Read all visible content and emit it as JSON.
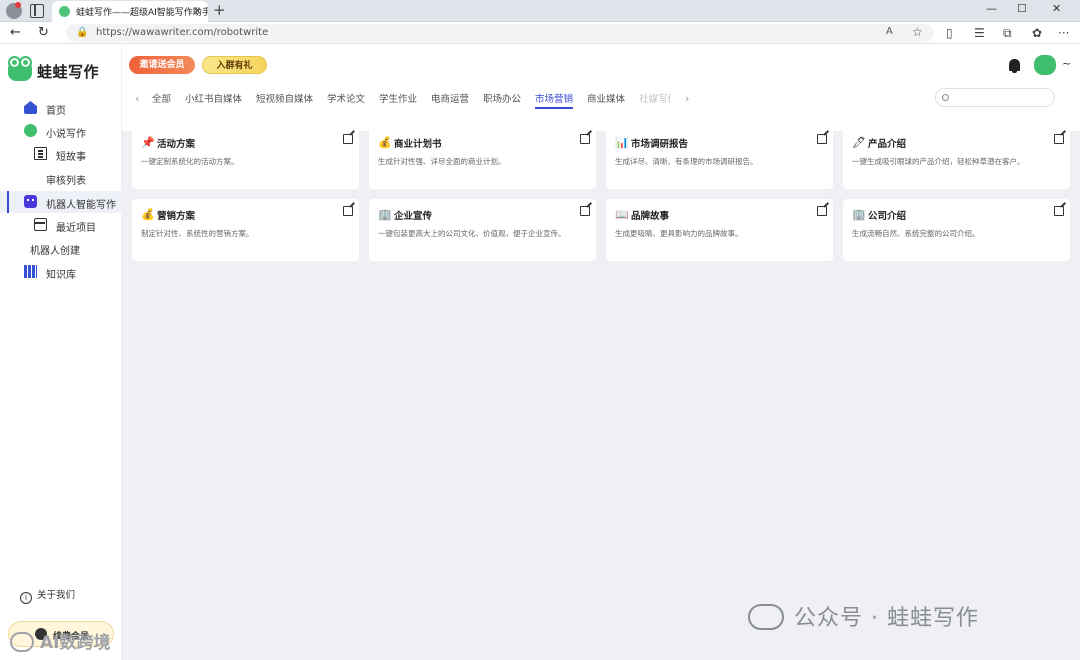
{
  "browser": {
    "tab_title": "蛙蛙写作——超级AI智能写作助手",
    "tab_close": "×",
    "new_tab": "+",
    "url": "https://wawawriter.com/robotwrite",
    "win_min": "—",
    "win_max": "☐",
    "win_close": "✕",
    "back": "←",
    "refresh": "↻",
    "read_aloud": "A",
    "favorite": "☆",
    "ellipsis": "···"
  },
  "sidebar": {
    "app_name": "蛙蛙写作",
    "items": [
      {
        "label": "首页",
        "icon": "home-icon"
      },
      {
        "label": "小说写作",
        "icon": "frog-icon"
      },
      {
        "label": "短故事",
        "icon": "book-icon"
      },
      {
        "label": "审核列表",
        "icon": ""
      },
      {
        "label": "机器人智能写作",
        "icon": "robot-icon"
      },
      {
        "label": "最近项目",
        "icon": "box-icon"
      },
      {
        "label": "机器人创建",
        "icon": ""
      },
      {
        "label": "知识库",
        "icon": "library-icon"
      }
    ],
    "active_index": 4,
    "about_label": "关于我们",
    "about_icon_char": "i",
    "member_label": "续费会员"
  },
  "header": {
    "invite_label": "邀请送会员",
    "group_label": "入群有礼",
    "user_suffix": "~"
  },
  "categories": {
    "prev_arrow": "‹",
    "next_arrow": "›",
    "items": [
      "全部",
      "小红书自媒体",
      "短视频自媒体",
      "学术论文",
      "学生作业",
      "电商运营",
      "职场办公",
      "市场营销",
      "商业媒体",
      "社媒写作"
    ],
    "active_index": 7
  },
  "cards": [
    {
      "emoji": "📌",
      "title": "活动方案",
      "desc": "一键定制系统化的活动方案。"
    },
    {
      "emoji": "💰",
      "title": "商业计划书",
      "desc": "生成针对性强、详尽全面的商业计划。"
    },
    {
      "emoji": "📊",
      "title": "市场调研报告",
      "desc": "生成详尽、清晰、有条理的市场调研报告。"
    },
    {
      "emoji": "🖊",
      "title": "产品介绍",
      "desc": "一键生成吸引眼球的产品介绍，轻松种草潜在客户。"
    },
    {
      "emoji": "💰",
      "title": "营销方案",
      "desc": "制定针对性、系统性的营销方案。"
    },
    {
      "emoji": "🏢",
      "title": "企业宣传",
      "desc": "一键包装更高大上的公司文化、价值观，便于企业宣传。"
    },
    {
      "emoji": "📖",
      "title": "品牌故事",
      "desc": "生成更吸睛、更具影响力的品牌故事。"
    },
    {
      "emoji": "🏢",
      "title": "公司介绍",
      "desc": "生成流畅自然、系统完整的公司介绍。"
    }
  ],
  "watermark": {
    "text": "公众号 · 蛙蛙写作",
    "text2": "AI数跨境"
  },
  "colors": {
    "accent": "#3a4bd8",
    "brand_green": "#3fbf6e",
    "invite_orange": "#f0613a",
    "main_bg": "#eef0f4"
  }
}
